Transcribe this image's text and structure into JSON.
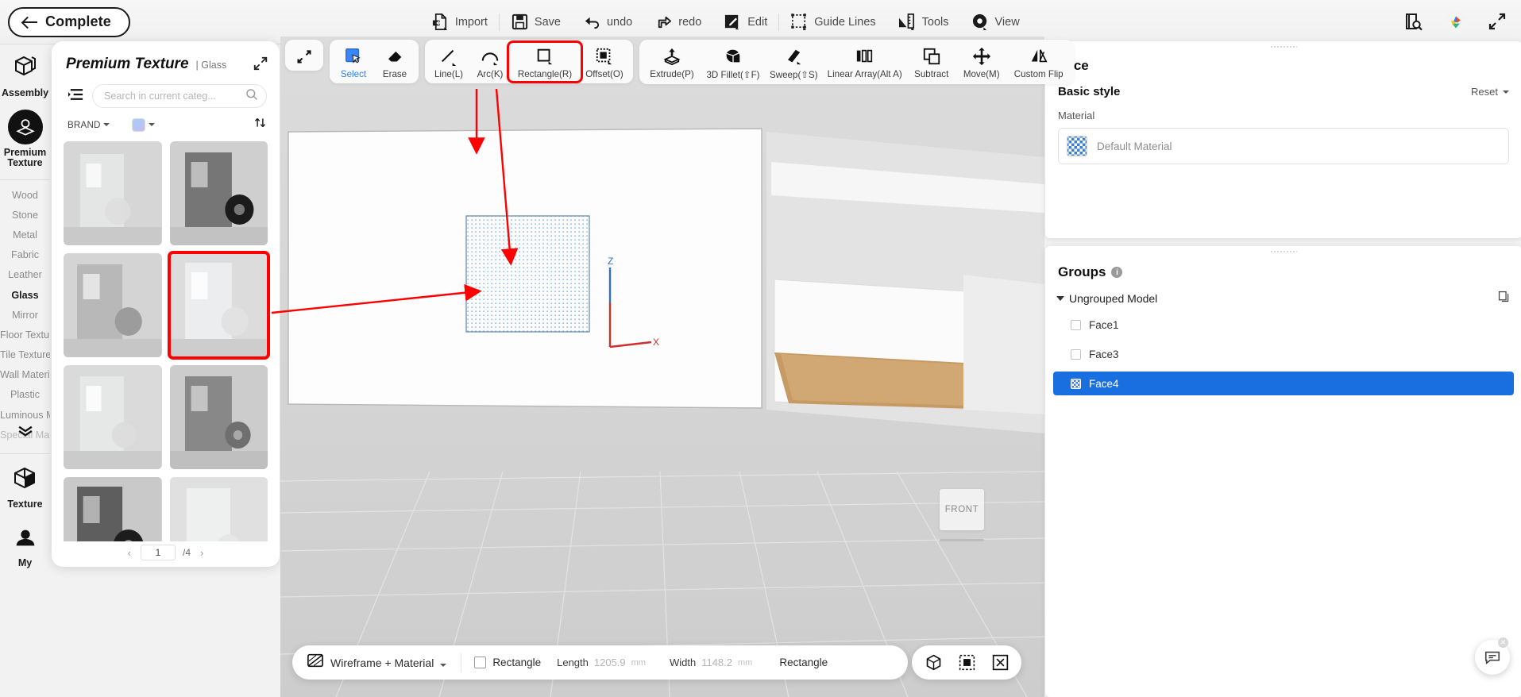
{
  "topbar": {
    "complete_label": "Complete",
    "back_icon": "arrow-left-icon",
    "menu": [
      {
        "label": "Import",
        "icon": "import-icon"
      },
      {
        "label": "Save",
        "icon": "save-icon"
      },
      {
        "label": "undo",
        "icon": "undo-icon"
      },
      {
        "label": "redo",
        "icon": "redo-icon"
      },
      {
        "label": "Edit",
        "icon": "edit-icon"
      },
      {
        "label": "Guide Lines",
        "icon": "guide-lines-icon"
      },
      {
        "label": "Tools",
        "icon": "tools-icon"
      },
      {
        "label": "View",
        "icon": "view-icon"
      }
    ],
    "right_icons": [
      "book-search-icon",
      "palette-icon",
      "fullscreen-icon"
    ]
  },
  "rail": {
    "assembly": {
      "label": "Assembly",
      "icon": "assembly-cube-icon"
    },
    "premium": {
      "label": "Premium Texture",
      "icon": "premium-texture-icon"
    },
    "categories": [
      "Wood",
      "Stone",
      "Metal",
      "Fabric",
      "Leather",
      "Glass",
      "Mirror",
      "Floor Texture",
      "Tile Texture",
      "Wall Material",
      "Plastic",
      "Luminous Material",
      "Special Material"
    ],
    "active_category": "Glass",
    "more_icon": "chevron-double-down-icon",
    "texture": {
      "label": "Texture",
      "icon": "texture-cube-icon"
    },
    "my": {
      "label": "My",
      "icon": "my-user-icon"
    }
  },
  "texture_panel": {
    "title": "Premium Texture",
    "subtitle": "Glass",
    "expand_icon": "expand-diagonal-icon",
    "filter_icon": "filter-list-icon",
    "search_placeholder": "Search in current categ...",
    "search_value": "",
    "search_icon": "search-icon",
    "brand_label": "BRAND",
    "sort_icon": "sort-updown-icon",
    "color_swatch": "#9fd2f7",
    "items": [
      {
        "name": "glass-swatch-1",
        "selected": false
      },
      {
        "name": "glass-swatch-2",
        "selected": false
      },
      {
        "name": "glass-swatch-3",
        "selected": false
      },
      {
        "name": "glass-swatch-4",
        "selected": true
      },
      {
        "name": "glass-swatch-5",
        "selected": false
      },
      {
        "name": "glass-swatch-6",
        "selected": false
      },
      {
        "name": "glass-swatch-7",
        "selected": false
      },
      {
        "name": "glass-swatch-8",
        "selected": false
      }
    ],
    "pager": {
      "prev": "‹",
      "page": "1",
      "total": "/4",
      "next": "›"
    }
  },
  "sketchbar": {
    "groups": [
      {
        "buttons": [
          {
            "label": "",
            "icon": "resize-arrows-icon",
            "active": false,
            "highlight": false
          }
        ]
      },
      {
        "buttons": [
          {
            "label": "Select",
            "icon": "select-icon",
            "active": true,
            "highlight": false
          },
          {
            "label": "Erase",
            "icon": "erase-icon",
            "active": false,
            "highlight": false
          }
        ]
      },
      {
        "buttons": [
          {
            "label": "Line(L)",
            "icon": "line-icon",
            "active": false,
            "highlight": false
          },
          {
            "label": "Arc(K)",
            "icon": "arc-icon",
            "active": false,
            "highlight": false
          },
          {
            "label": "Rectangle(R)",
            "icon": "rectangle-icon",
            "active": false,
            "highlight": true
          },
          {
            "label": "Offset(O)",
            "icon": "offset-icon",
            "active": false,
            "highlight": false
          }
        ]
      },
      {
        "buttons": [
          {
            "label": "Extrude(P)",
            "icon": "extrude-icon",
            "active": false,
            "highlight": false
          },
          {
            "label": "3D Fillet(⇧F)",
            "icon": "fillet-icon",
            "active": false,
            "highlight": false
          },
          {
            "label": "Sweep(⇧S)",
            "icon": "sweep-icon",
            "active": false,
            "highlight": false
          },
          {
            "label": "Linear Array(Alt A)",
            "icon": "linear-array-icon",
            "active": false,
            "highlight": false
          },
          {
            "label": "Subtract",
            "icon": "subtract-icon",
            "active": false,
            "highlight": false
          },
          {
            "label": "Move(M)",
            "icon": "move-icon",
            "active": false,
            "highlight": false
          },
          {
            "label": "Custom Flip",
            "icon": "custom-flip-icon",
            "active": false,
            "highlight": false
          }
        ]
      }
    ]
  },
  "viewport": {
    "axis_z": "Z",
    "axis_x": "X",
    "view_cube_label": "FRONT"
  },
  "bottombar": {
    "mode_label": "Wireframe + Material",
    "mode_icon": "wireframe-material-icon",
    "shape_label": "Rectangle",
    "shape_icon": "rectangle-outline-icon",
    "length_label": "Length",
    "length_value": "1205.9",
    "length_unit": "mm",
    "width_label": "Width",
    "width_value": "1148.2",
    "width_unit": "mm",
    "status_label": "Rectangle",
    "view_tools": [
      "box-view-icon",
      "fit-view-icon",
      "close-view-icon"
    ]
  },
  "right_panel": {
    "face": {
      "title": "Face",
      "basic_style_label": "Basic style",
      "reset_label": "Reset",
      "reset_caret": "chevron-down-icon",
      "material_label": "Material",
      "material_name": "Default Material",
      "material_thumb": "checker-thumb-icon"
    },
    "groups": {
      "title": "Groups",
      "info_icon": "info-icon",
      "section_label": "Ungrouped Model",
      "copy_icon": "copy-icon",
      "items": [
        {
          "label": "Face1",
          "selected": false
        },
        {
          "label": "Face3",
          "selected": false
        },
        {
          "label": "Face4",
          "selected": true
        }
      ]
    }
  },
  "fab": {
    "icon": "feedback-chat-icon",
    "close_icon": "close-icon",
    "close_glyph": "✕"
  }
}
